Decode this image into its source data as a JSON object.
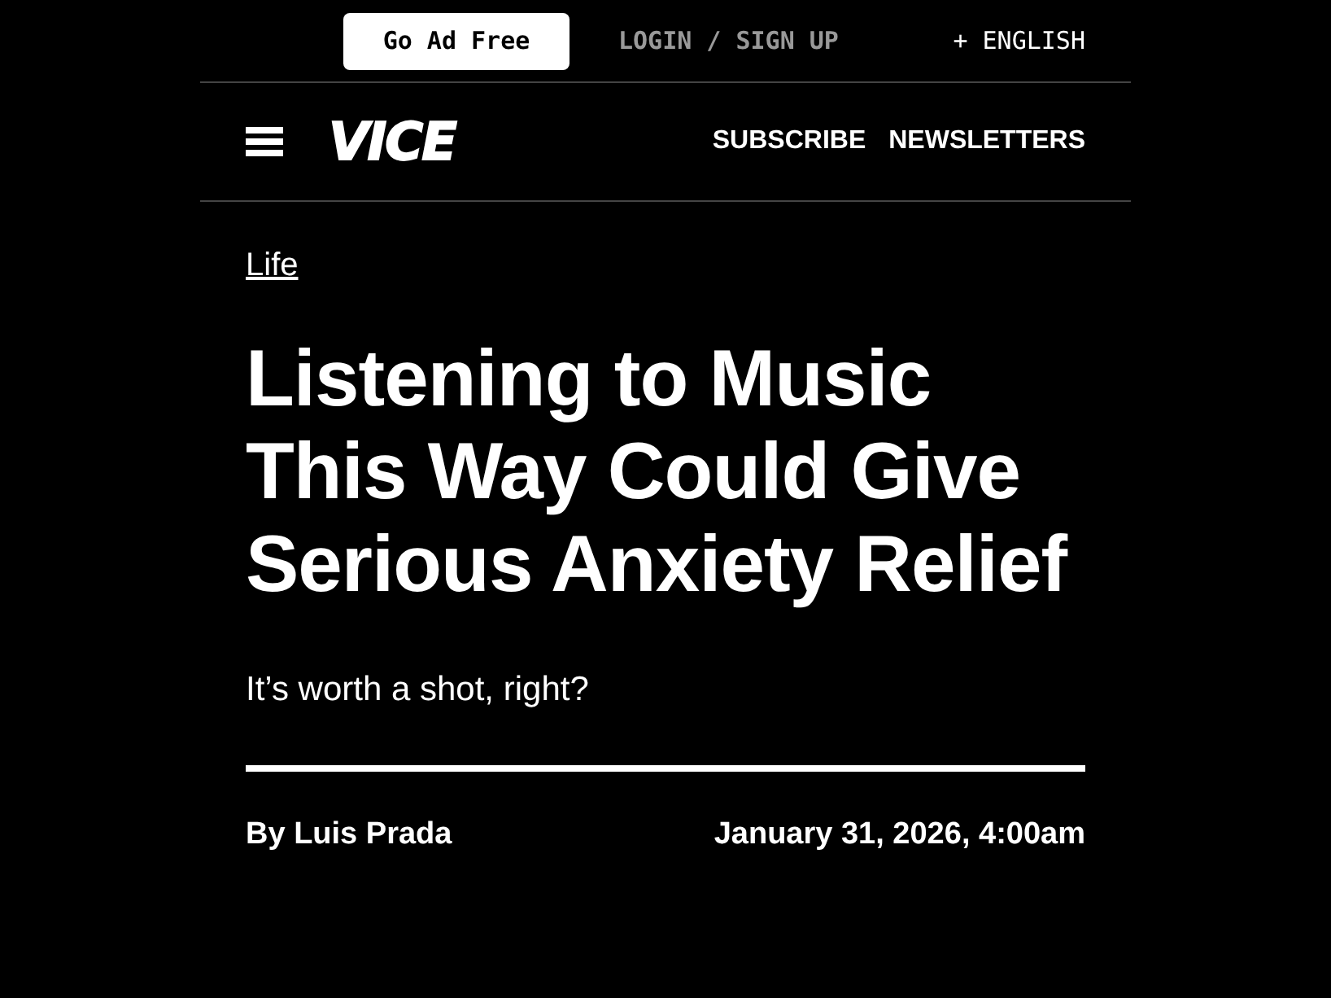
{
  "top_bar": {
    "ad_free_button": "Go Ad Free",
    "login_link": "LOGIN / SIGN UP",
    "language": "+ ENGLISH"
  },
  "nav": {
    "logo": "VICE",
    "links": [
      "SUBSCRIBE",
      "NEWSLETTERS"
    ]
  },
  "article": {
    "category": "Life",
    "headline": "Listening to Music This Way Could Give Serious Anxiety Relief",
    "subtitle": "It’s worth a shot, right?",
    "byline": "By Luis Prada",
    "date": "January 31, 2026, 4:00am"
  }
}
